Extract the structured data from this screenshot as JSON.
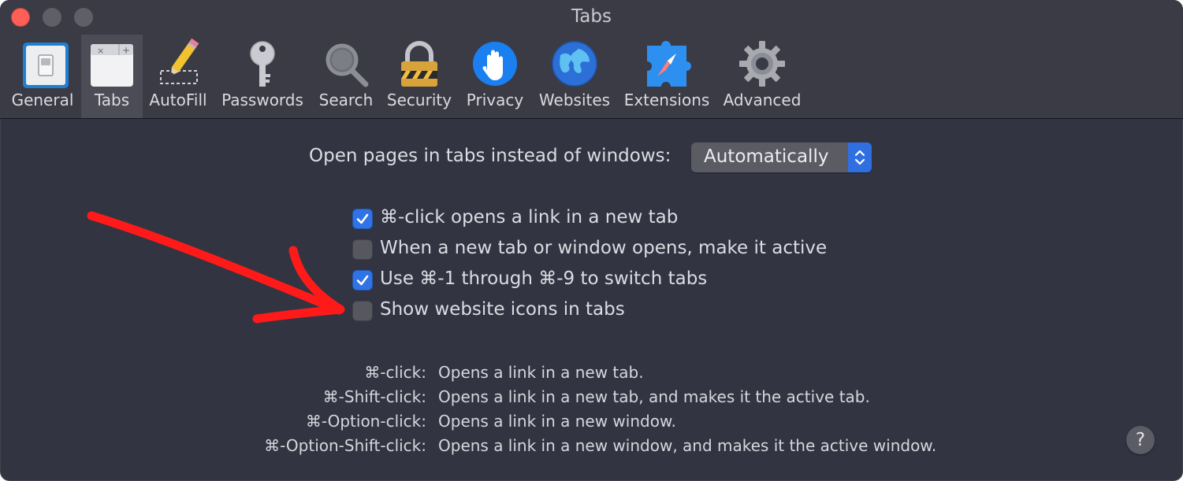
{
  "window": {
    "title": "Tabs"
  },
  "toolbar": {
    "tabs": [
      {
        "label": "General",
        "icon": "general-switch-icon"
      },
      {
        "label": "Tabs",
        "icon": "tabs-icon",
        "selected": true
      },
      {
        "label": "AutoFill",
        "icon": "pencil-icon"
      },
      {
        "label": "Passwords",
        "icon": "key-icon"
      },
      {
        "label": "Search",
        "icon": "magnifier-icon"
      },
      {
        "label": "Security",
        "icon": "padlock-icon"
      },
      {
        "label": "Privacy",
        "icon": "hand-icon"
      },
      {
        "label": "Websites",
        "icon": "globe-icon"
      },
      {
        "label": "Extensions",
        "icon": "puzzle-compass-icon"
      },
      {
        "label": "Advanced",
        "icon": "gear-icon"
      }
    ]
  },
  "content": {
    "open_pages_label": "Open pages in tabs instead of windows:",
    "open_pages_value": "Automatically",
    "checkboxes": [
      {
        "label": "⌘-click opens a link in a new tab",
        "checked": true
      },
      {
        "label": "When a new tab or window opens, make it active",
        "checked": false
      },
      {
        "label": "Use ⌘-1 through ⌘-9 to switch tabs",
        "checked": true
      },
      {
        "label": "Show website icons in tabs",
        "checked": false
      }
    ],
    "help_rows": [
      {
        "key": "⌘-click:",
        "desc": "Opens a link in a new tab."
      },
      {
        "key": "⌘-Shift-click:",
        "desc": "Opens a link in a new tab, and makes it the active tab."
      },
      {
        "key": "⌘-Option-click:",
        "desc": "Opens a link in a new window."
      },
      {
        "key": "⌘-Option-Shift-click:",
        "desc": "Opens a link in a new window, and makes it the active window."
      }
    ],
    "help_button": "?"
  },
  "colors": {
    "accent": "#2f73e6",
    "annotation": "#ff1a1a",
    "background": "#323441"
  }
}
